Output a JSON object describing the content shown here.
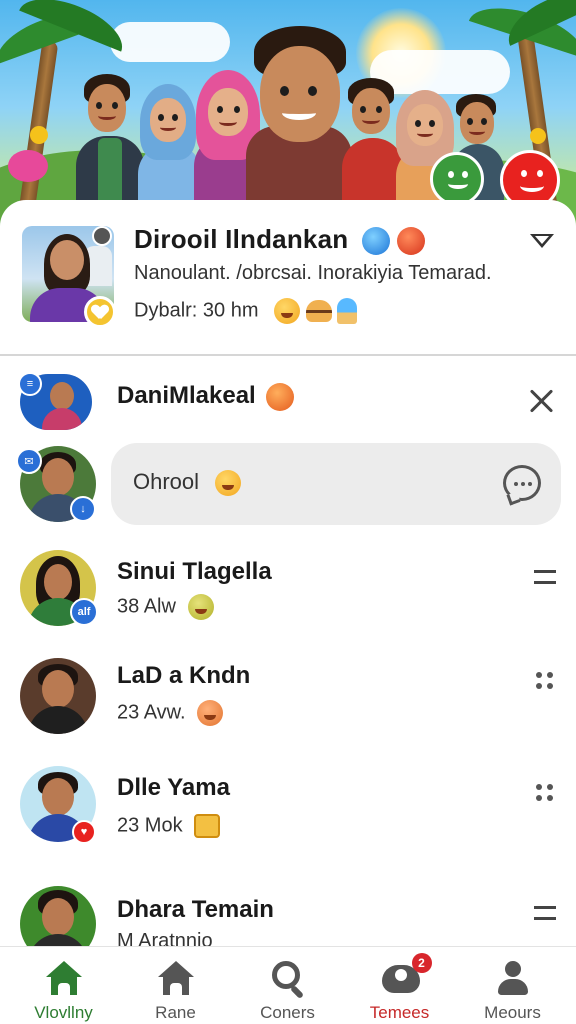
{
  "banner": {
    "status_buttons": [
      {
        "icon": "green-smile-face-icon",
        "color": "#3a9a3c"
      },
      {
        "icon": "red-smile-face-icon",
        "color": "#e8221f"
      }
    ]
  },
  "profile": {
    "name": "Diroоil Ilndankan",
    "subtitle": "Nanoulant. /obrcsai. Inorakiyia Temarad.",
    "meta": "Dybalr: 30 hm",
    "menu_icon": "chevron-down-icon"
  },
  "list": [
    {
      "name": "DaniMlakeal",
      "sub": "",
      "action": "close-icon"
    },
    {
      "name": "",
      "sub": "",
      "reply_text": "Ohrool",
      "action": "chat-bubble-icon"
    },
    {
      "name": "Sinui Tlagella",
      "sub": "38 Alw",
      "badge": "alf",
      "action": "menu-icon"
    },
    {
      "name": "LaD a Kndn",
      "sub": "23 Avw.",
      "action": "dots-icon"
    },
    {
      "name": "Dlle Yama",
      "sub": "23 Mok",
      "action": "dots-icon"
    },
    {
      "name": "Dhara Temain",
      "sub": "M Aratnnio",
      "action": "menu-icon"
    }
  ],
  "nav": {
    "items": [
      {
        "label": "Vlovllny",
        "icon": "home-icon",
        "active": true,
        "color": "#2e7d32"
      },
      {
        "label": "Rane",
        "icon": "home-outline-icon"
      },
      {
        "label": "Coners",
        "icon": "search-icon"
      },
      {
        "label": "Temees",
        "icon": "group-icon",
        "badge": "2",
        "color": "#c62828"
      },
      {
        "label": "Meours",
        "icon": "user-icon"
      }
    ]
  },
  "colors": {
    "accent_green": "#2e7d32",
    "accent_red": "#c62828",
    "bubble": "#ececec"
  }
}
